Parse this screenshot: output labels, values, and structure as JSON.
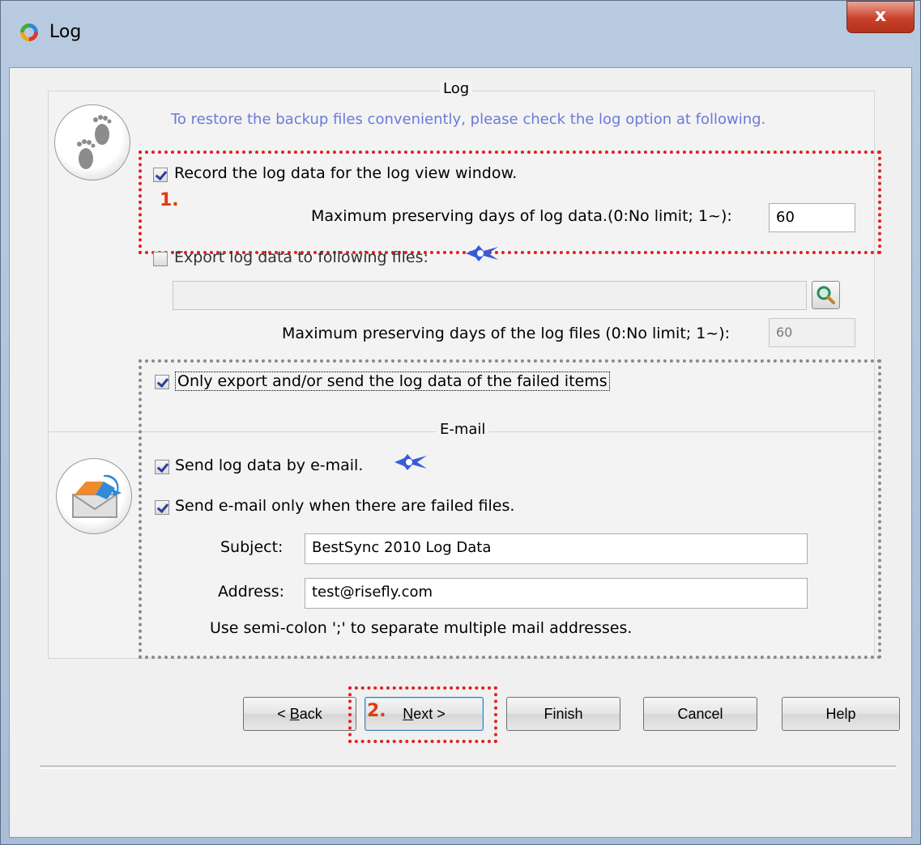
{
  "window": {
    "title": "Log",
    "close_label": "x"
  },
  "log_section": {
    "title": "Log",
    "info": "To restore the backup files conveniently, please check the log option at following.",
    "record_label": "Record the log data for the log view window.",
    "record_checked": true,
    "max_days_label": "Maximum preserving days of log data.(0:No limit; 1~):",
    "max_days_value": "60",
    "export_label": "Export log data to following files:",
    "export_checked": false,
    "export_path_value": "",
    "max_files_days_label": "Maximum preserving days of the log files (0:No limit; 1~):",
    "max_files_days_value": "60",
    "only_failed_label": "Only export and/or send the log data of the failed items",
    "only_failed_checked": true
  },
  "email_section": {
    "title": "E-mail",
    "send_label": "Send log data by e-mail.",
    "send_checked": true,
    "only_failed_label": "Send e-mail only when there are failed files.",
    "only_failed_checked": true,
    "subject_label": "Subject:",
    "subject_value": "BestSync 2010 Log Data",
    "address_label": "Address:",
    "address_value": "test@risefly.com",
    "hint": "Use semi-colon ';' to separate multiple mail addresses."
  },
  "annotations": {
    "marker1": "1.",
    "marker2": "2."
  },
  "buttons": {
    "back_prefix": "< ",
    "back_key": "B",
    "back_rest": "ack",
    "next_key": "N",
    "next_rest": "ext >",
    "finish": "Finish",
    "cancel": "Cancel",
    "help": "Help"
  },
  "colors": {
    "info_text": "#6b79d9",
    "annotation_red": "#e02020",
    "title_bar": "#b9cbe0"
  }
}
